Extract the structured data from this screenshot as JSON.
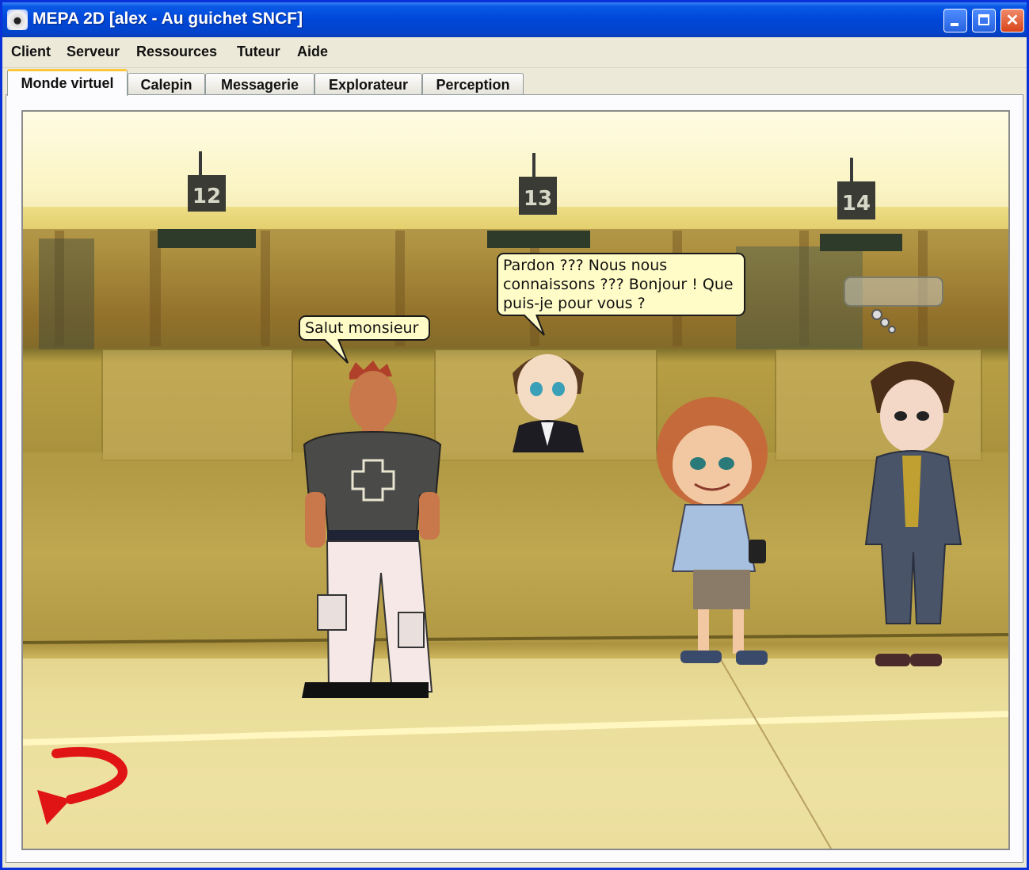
{
  "window": {
    "title": "MEPA 2D [alex - Au guichet SNCF]",
    "controls": {
      "minimize": "minimize",
      "maximize": "maximize",
      "close": "✕"
    }
  },
  "menubar": {
    "items": [
      "Client",
      "Serveur",
      "Ressources",
      "Tuteur",
      "Aide"
    ]
  },
  "tabs": [
    {
      "label": "Monde virtuel",
      "active": true
    },
    {
      "label": "Calepin",
      "active": false
    },
    {
      "label": "Messagerie",
      "active": false
    },
    {
      "label": "Explorateur",
      "active": false
    },
    {
      "label": "Perception",
      "active": false
    }
  ],
  "scene": {
    "counters": [
      "12",
      "13",
      "14"
    ],
    "bubbles": {
      "alex": "Salut monsieur",
      "clerk_line1": "Pardon ??? Nous nous",
      "clerk_line2": "connaissons ??? Bonjour ! Que",
      "clerk_line3": "puis-je pour vous ?"
    },
    "back_arrow_icon": "back-arrow-icon",
    "colors": {
      "arrow": "#e01414",
      "bubble": "#fffcc8",
      "titlebar": "#0047d8"
    }
  }
}
